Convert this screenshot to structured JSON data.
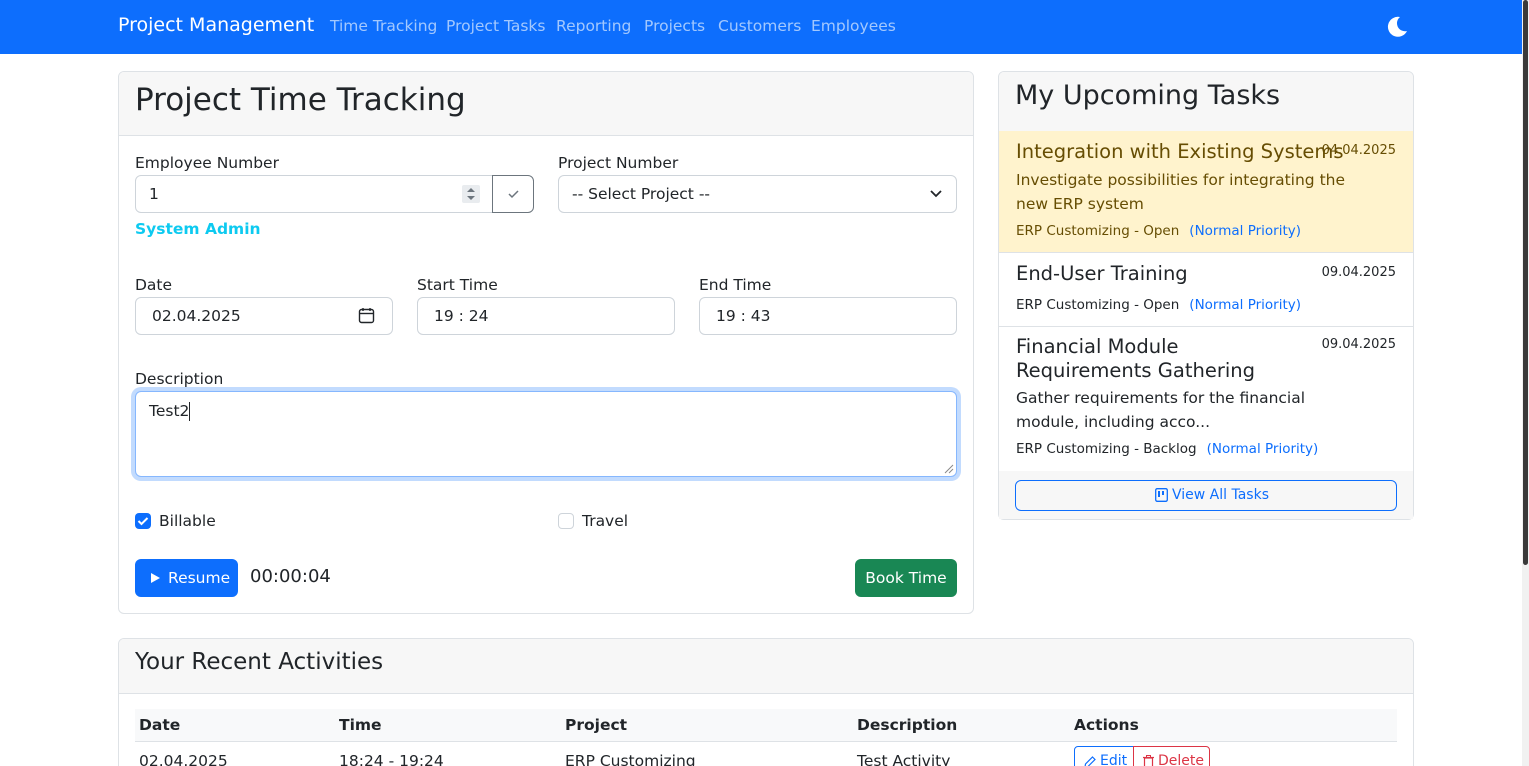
{
  "nav": {
    "brand": "Project Management",
    "links": [
      "Time Tracking",
      "Project Tasks",
      "Reporting",
      "Projects",
      "Customers",
      "Employees"
    ],
    "theme_icon": "moon-icon"
  },
  "tracking": {
    "title": "Project Time Tracking",
    "employee_label": "Employee Number",
    "employee_value": "1",
    "employee_name": "System Admin",
    "project_label": "Project Number",
    "project_value": "-- Select Project --",
    "date_label": "Date",
    "date_value": "02.04.2025",
    "start_label": "Start Time",
    "start_value": "19 : 24",
    "end_label": "End Time",
    "end_value": "19 : 43",
    "description_label": "Description",
    "description_value": "Test2",
    "billable_label": "Billable",
    "billable_checked": true,
    "travel_label": "Travel",
    "travel_checked": false,
    "resume_label": "Resume",
    "timer": "00:00:04",
    "book_label": "Book Time"
  },
  "tasks": {
    "title": "My Upcoming Tasks",
    "items": [
      {
        "title": "Integration with Existing Systems",
        "date": "04.04.2025",
        "desc": "Investigate possibilities for integrating the new ERP system",
        "meta": "ERP Customizing - Open",
        "priority": "(Normal Priority)"
      },
      {
        "title": "End-User Training",
        "date": "09.04.2025",
        "desc": "",
        "meta": "ERP Customizing - Open",
        "priority": "(Normal Priority)"
      },
      {
        "title": "Financial Module Requirements Gathering",
        "date": "09.04.2025",
        "desc": "Gather requirements for the financial module, including acco...",
        "meta": "ERP Customizing - Backlog",
        "priority": "(Normal Priority)"
      }
    ],
    "view_all_label": "View All Tasks"
  },
  "activities": {
    "title": "Your Recent Activities",
    "headers": [
      "Date",
      "Time",
      "Project",
      "Description",
      "Actions"
    ],
    "rows": [
      {
        "date": "02.04.2025",
        "time": "18:24 - 19:24",
        "project": "ERP Customizing",
        "description": "Test Activity",
        "edit": "Edit",
        "delete": "Delete"
      }
    ]
  },
  "colors": {
    "primary": "#0d6efd",
    "success": "#198754",
    "danger": "#dc3545",
    "info": "#0dcaf0",
    "highlight": "#fff3cd"
  }
}
